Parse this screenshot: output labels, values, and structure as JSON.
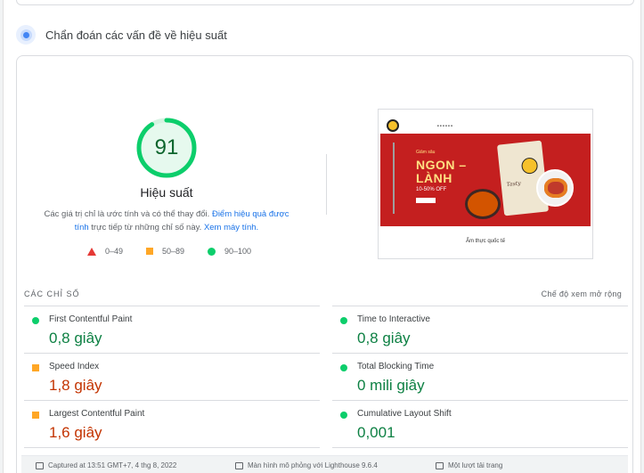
{
  "section": {
    "title": "Chẩn đoán các vấn đề về hiệu suất",
    "icon": "diagnostics-icon"
  },
  "performance": {
    "score": "91",
    "score_fraction": 0.91,
    "label": "Hiệu suất",
    "desc_before": "Các giá trị chỉ là ước tính và có thể thay đổi. ",
    "desc_link1": "Điểm hiệu quả được tính",
    "desc_middle": " trực tiếp từ những chỉ số này. ",
    "desc_link2": "Xem máy tính.",
    "colors": {
      "good": "#0cce6b",
      "good_text": "#0d8043",
      "average": "#ffa726",
      "poor": "#e53935"
    }
  },
  "legend": [
    {
      "icon": "triangle-red-icon",
      "label": "0–49"
    },
    {
      "icon": "square-orange-icon",
      "label": "50–89"
    },
    {
      "icon": "circle-green-icon",
      "label": "90–100"
    }
  ],
  "screenshot": {
    "hero_small": "Giảm sâu",
    "hero_big_1": "NGON –",
    "hero_big_2": "LÀNH",
    "hero_off": "10-50% OFF",
    "section_title": "Ẩm thực quốc tế"
  },
  "metrics": {
    "label": "CÁC CHỈ SỐ",
    "expand_link": "Chế độ xem mở rộng",
    "left": [
      {
        "name": "First Contentful Paint",
        "value": "0,8 giây",
        "status": "good"
      },
      {
        "name": "Speed Index",
        "value": "1,8 giây",
        "status": "average"
      },
      {
        "name": "Largest Contentful Paint",
        "value": "1,6 giây",
        "status": "average"
      }
    ],
    "right": [
      {
        "name": "Time to Interactive",
        "value": "0,8 giây",
        "status": "good"
      },
      {
        "name": "Total Blocking Time",
        "value": "0 mili giây",
        "status": "good"
      },
      {
        "name": "Cumulative Layout Shift",
        "value": "0,001",
        "status": "good"
      }
    ]
  },
  "footer": {
    "captured": "Captured at 13:51 GMT+7, 4 thg 8, 2022",
    "device": "Màn hình mô phỏng với Lighthouse 9.6.4",
    "load": "Một lượt tải trang"
  }
}
